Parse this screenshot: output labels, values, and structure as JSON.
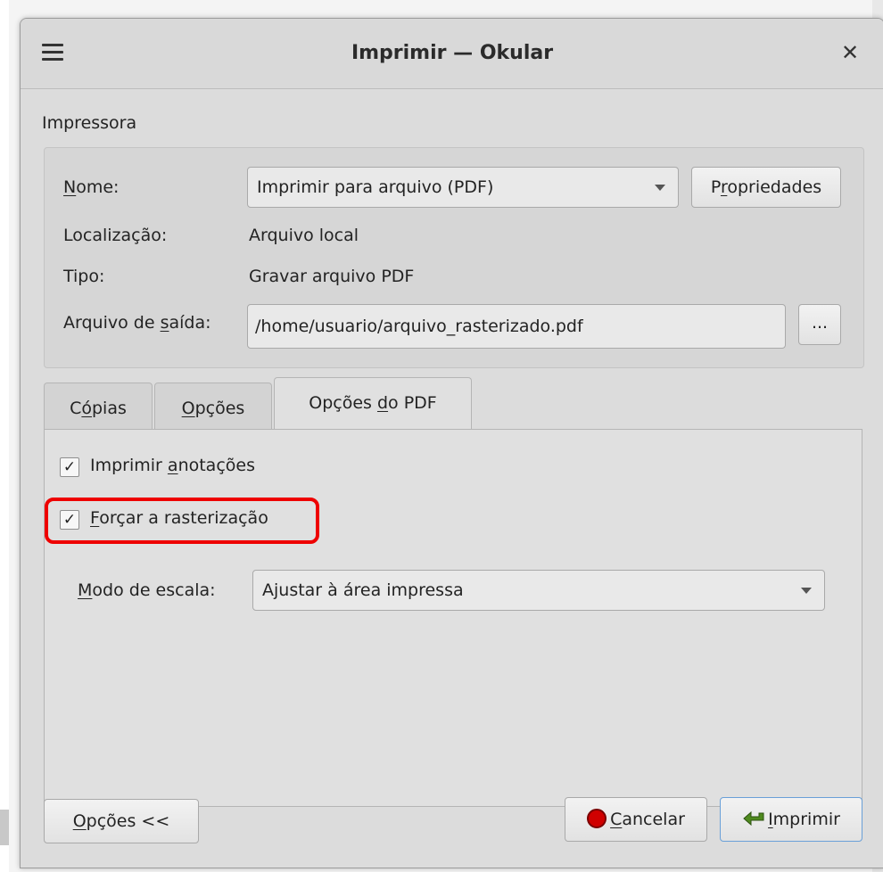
{
  "window": {
    "title": "Imprimir — Okular"
  },
  "printer": {
    "section_label": "Impressora",
    "name_label": "Nome:",
    "name_value": "Imprimir para arquivo (PDF)",
    "properties_button": "Propriedades",
    "location_label": "Localização:",
    "location_value": "Arquivo local",
    "type_label": "Tipo:",
    "type_value": "Gravar arquivo PDF",
    "output_file_label": "Arquivo de saída:",
    "output_file_value": "/home/usuario/arquivo_rasterizado.pdf",
    "browse_button": "..."
  },
  "tabs": [
    {
      "label": "Cópias",
      "active": false
    },
    {
      "label": "Opções",
      "active": false
    },
    {
      "label": "Opções do PDF",
      "active": true
    }
  ],
  "pdf_options": {
    "print_annotations": {
      "label": "Imprimir anotações",
      "checked": true
    },
    "force_rasterization": {
      "label": "Forçar a rasterização",
      "checked": true
    },
    "scale_mode_label": "Modo de escala:",
    "scale_mode_value": "Ajustar à área impressa"
  },
  "buttons": {
    "options": "Opções <<",
    "cancel": "Cancelar",
    "print": "Imprimir"
  },
  "colors": {
    "highlight": "#ee0000",
    "window_bg": "#dcdcdc"
  }
}
